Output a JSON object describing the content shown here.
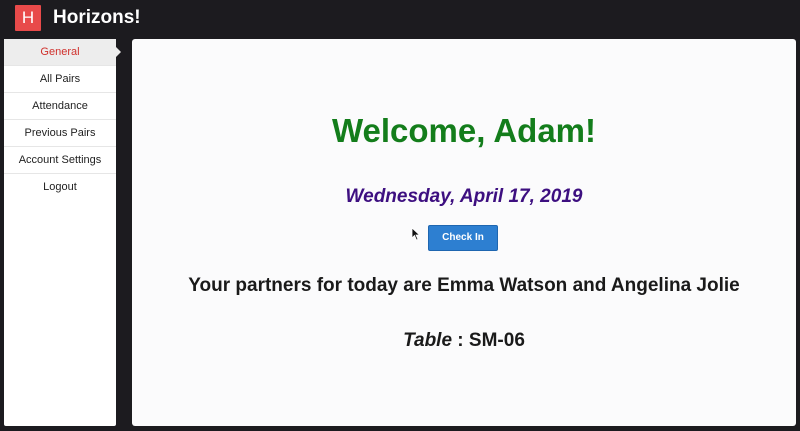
{
  "app": {
    "logo_letter": "H",
    "brand": "Horizons!"
  },
  "sidebar": {
    "items": [
      {
        "label": "General",
        "active": true
      },
      {
        "label": "All Pairs"
      },
      {
        "label": "Attendance"
      },
      {
        "label": "Previous Pairs"
      },
      {
        "label": "Account Settings"
      },
      {
        "label": "Logout"
      }
    ]
  },
  "main": {
    "welcome": "Welcome, Adam!",
    "date": "Wednesday, April 17, 2019",
    "checkin_label": "Check In",
    "partners_text": "Your partners for today are Emma Watson and Angelina Jolie",
    "table_label": "Table",
    "table_separator": " : ",
    "table_value": "SM-06"
  },
  "colors": {
    "logo_bg": "#e84a4a",
    "active_nav_text": "#d0312d",
    "welcome": "#137d1b",
    "date": "#3d0f80",
    "button": "#2d7fd1"
  },
  "icons": {
    "cursor": "mouse-pointer-icon"
  }
}
